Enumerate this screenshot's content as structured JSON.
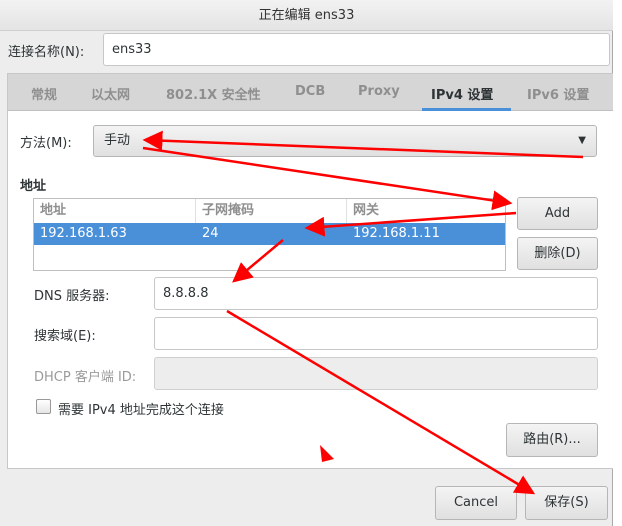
{
  "window": {
    "title": "正在编辑 ens33"
  },
  "connection_name": {
    "label": "连接名称(N):",
    "value": "ens33"
  },
  "tabs": [
    {
      "label": "常规"
    },
    {
      "label": "以太网"
    },
    {
      "label": "802.1X 安全性"
    },
    {
      "label": "DCB"
    },
    {
      "label": "Proxy"
    },
    {
      "label": "IPv4 设置",
      "active": true
    },
    {
      "label": "IPv6 设置"
    }
  ],
  "ipv4": {
    "method_label": "方法(M):",
    "method_value": "手动",
    "addresses_heading": "地址",
    "table": {
      "columns": [
        "地址",
        "子网掩码",
        "网关"
      ],
      "rows": [
        [
          "192.168.1.63",
          "24",
          "192.168.1.11"
        ]
      ]
    },
    "add_label": "Add",
    "delete_label": "删除(D)",
    "dns_label": "DNS 服务器:",
    "dns_value": "8.8.8.8",
    "search_label": "搜索域(E):",
    "search_value": "",
    "dhcp_label": "DHCP 客户端 ID:",
    "dhcp_value": "",
    "require_label": "需要 IPv4 地址完成这个连接",
    "require_checked": false,
    "routes_label": "路由(R)..."
  },
  "footer": {
    "cancel_label": "Cancel",
    "save_label": "保存(S)"
  },
  "annotation_color": "#ff0000"
}
